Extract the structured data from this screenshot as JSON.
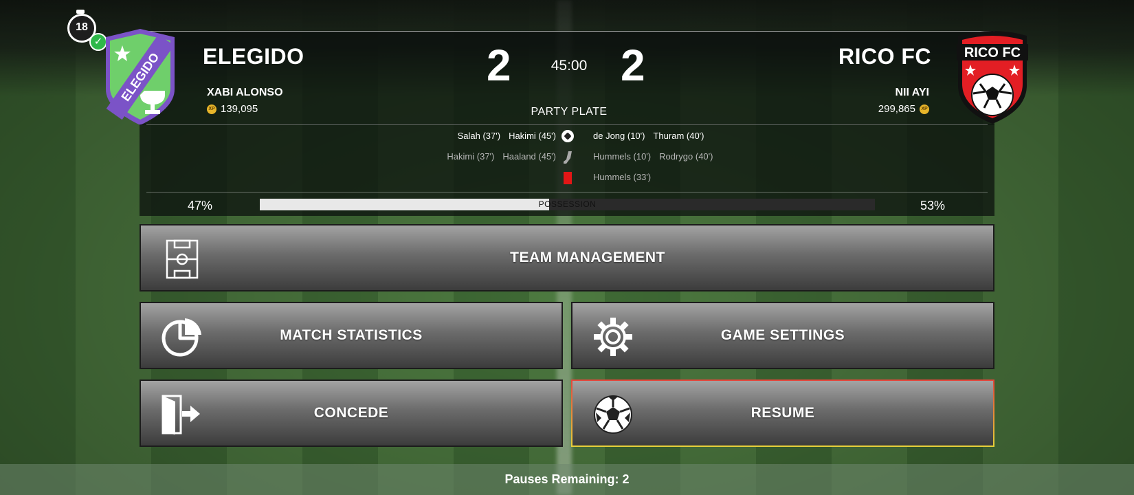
{
  "timer": {
    "value": "18"
  },
  "home": {
    "name": "ELEGIDO",
    "crest_text": "ELEGIDO",
    "manager": "XABI ALONSO",
    "xp": "139,095",
    "score": "2",
    "crest_color": "#6fcf6b",
    "crest_band": "#7b53c7"
  },
  "away": {
    "name": "RICO FC",
    "crest_text": "RICO FC",
    "manager": "NII AYI",
    "xp": "299,865",
    "score": "2",
    "crest_color": "#e31e24"
  },
  "match": {
    "clock": "45:00",
    "competition": "PARTY PLATE"
  },
  "xp_badge": "XP",
  "events": {
    "goals": {
      "home": [
        "Salah (37')",
        "Hakimi (45')"
      ],
      "away": [
        "de Jong (10')",
        "Thuram (40')"
      ]
    },
    "assists": {
      "home": [
        "Hakimi (37')",
        "Haaland (45')"
      ],
      "away": [
        "Hummels (10')",
        "Rodrygo (40')"
      ]
    },
    "red_cards": {
      "home": [],
      "away": [
        "Hummels (33')"
      ]
    }
  },
  "possession": {
    "label": "POSSESSION",
    "home_pct": "47%",
    "away_pct": "53%",
    "home_value": 47
  },
  "menu": {
    "team_management": "TEAM MANAGEMENT",
    "match_statistics": "MATCH STATISTICS",
    "game_settings": "GAME SETTINGS",
    "concede": "CONCEDE",
    "resume": "RESUME"
  },
  "footer": {
    "pauses": "Pauses Remaining: 2"
  },
  "icons": {
    "team_management": "pitch-formation-icon",
    "match_statistics": "pie-chart-icon",
    "game_settings": "gear-icon",
    "concede": "exit-door-icon",
    "resume": "football-icon"
  }
}
